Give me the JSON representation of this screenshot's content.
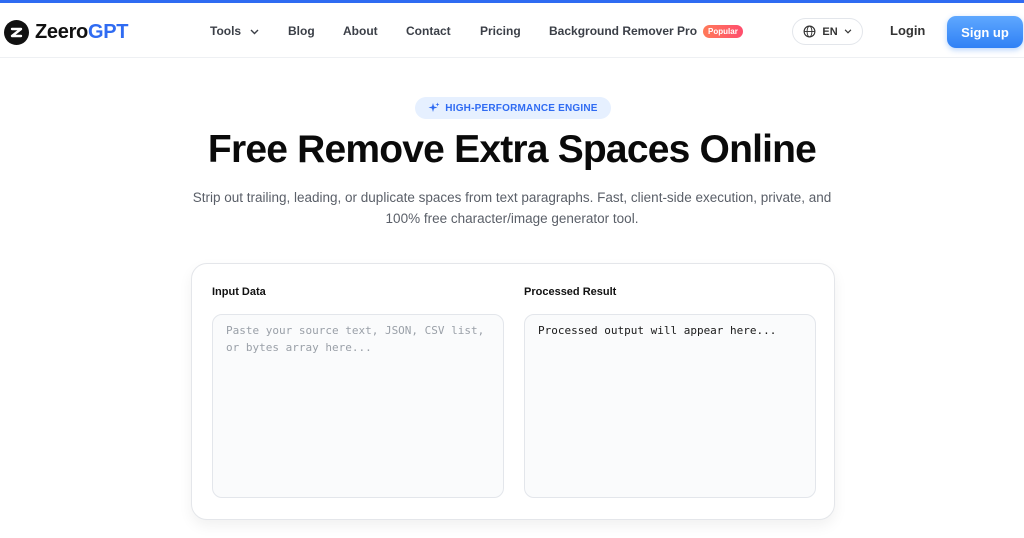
{
  "brand": {
    "name_part1": "Zeero",
    "name_part2": "GPT",
    "accent": "#2f6bf2"
  },
  "nav": {
    "tools": "Tools",
    "blog": "Blog",
    "about": "About",
    "contact": "Contact",
    "pricing": "Pricing",
    "bg_remover": "Background Remover Pro",
    "bg_remover_badge": "Popular"
  },
  "lang": {
    "value": "EN",
    "icon": "globe-icon"
  },
  "auth": {
    "login": "Login",
    "signup": "Sign up"
  },
  "hero": {
    "badge": "HIGH-PERFORMANCE ENGINE",
    "title": "Free Remove Extra Spaces Online",
    "subtitle_line1": "Strip out trailing, leading, or duplicate spaces from text paragraphs. Fast, client-side execution, private, and",
    "subtitle_line2": "100% free character/image generator tool."
  },
  "tool": {
    "input_label": "Input Data",
    "input_placeholder": "Paste your source text, JSON, CSV list, or bytes array here...",
    "input_value": "",
    "output_label": "Processed Result",
    "output_value": "Processed output will appear here..."
  }
}
